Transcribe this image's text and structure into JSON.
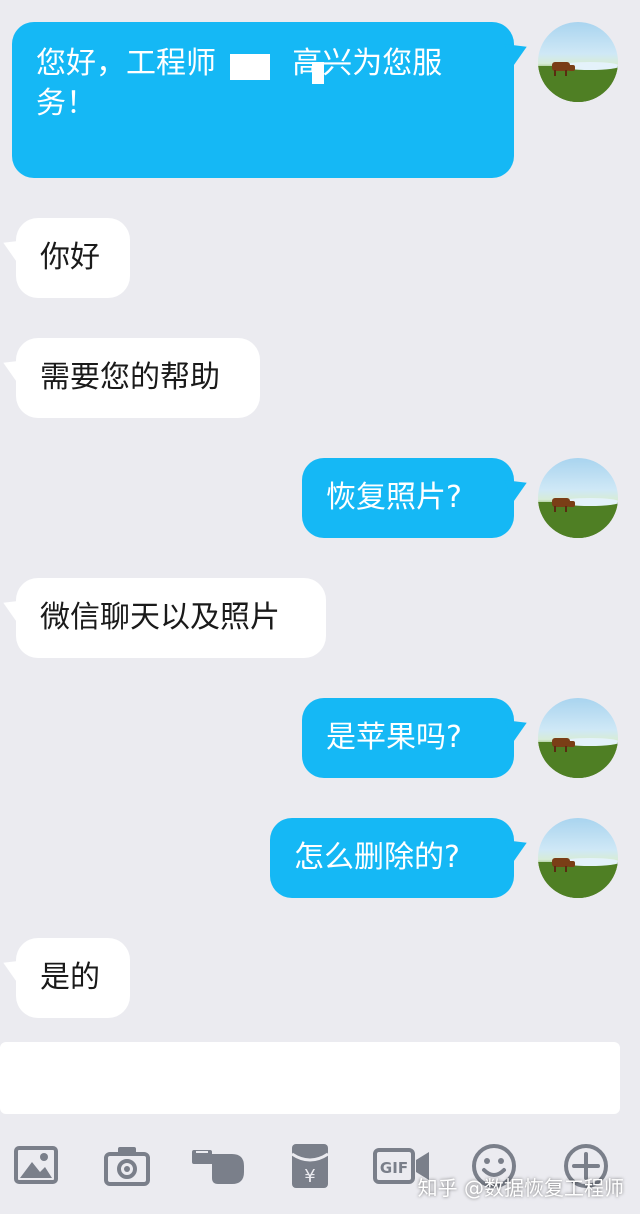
{
  "messages": [
    {
      "from": "self",
      "text": "您好，工程师        高兴为您服务！"
    },
    {
      "from": "other",
      "text": "你好"
    },
    {
      "from": "other",
      "text": "需要您的帮助"
    },
    {
      "from": "self",
      "text": "恢复照片?"
    },
    {
      "from": "other",
      "text": "微信聊天以及照片"
    },
    {
      "from": "self",
      "text": "是苹果吗?"
    },
    {
      "from": "self",
      "text": "怎么删除的?"
    },
    {
      "from": "other",
      "text": "是的"
    }
  ],
  "first_message_lines": [
    "您好，工程师        高兴为您服",
    "务！"
  ],
  "input": {
    "value": "",
    "placeholder": ""
  },
  "toolbar": {
    "icons": [
      "image-icon",
      "camera-icon",
      "poke-icon",
      "red-packet-icon",
      "gif-icon",
      "emoji-icon",
      "plus-icon"
    ]
  },
  "watermark": "知乎 @数据恢复工程师",
  "colors": {
    "outgoing": "#15b8f5",
    "incoming": "#ffffff",
    "background": "#ebebf0",
    "icon": "#7a7f8a"
  }
}
